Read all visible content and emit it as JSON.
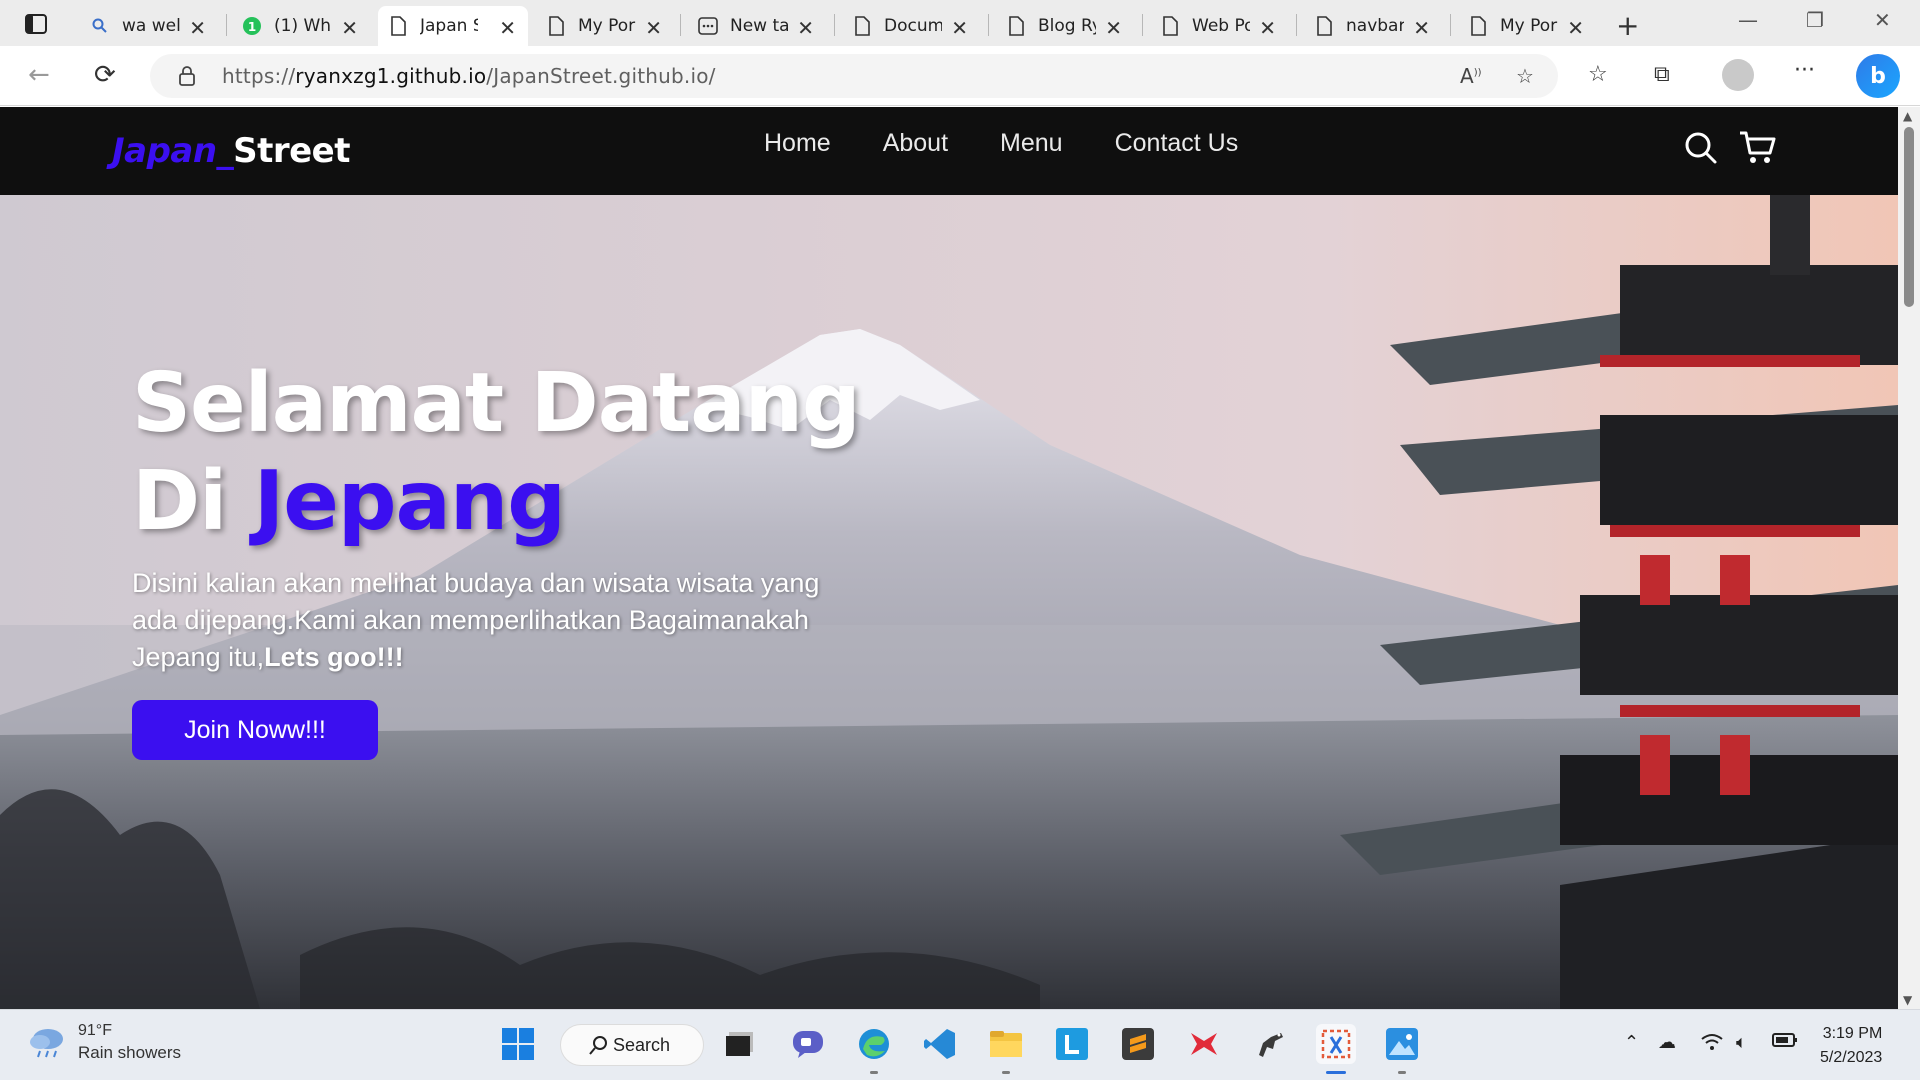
{
  "browser": {
    "tabs": [
      {
        "label": "wa wel",
        "icon": "search-icon"
      },
      {
        "label": "(1) Wh",
        "icon": "whatsapp-icon"
      },
      {
        "label": "Japan S",
        "icon": "page-icon",
        "active": true
      },
      {
        "label": "My Por",
        "icon": "page-icon"
      },
      {
        "label": "New ta",
        "icon": "newtab-icon"
      },
      {
        "label": "Docum",
        "icon": "page-icon"
      },
      {
        "label": "Blog Ry",
        "icon": "page-icon"
      },
      {
        "label": "Web Po",
        "icon": "page-icon"
      },
      {
        "label": "navbar",
        "icon": "page-icon"
      },
      {
        "label": "My Por",
        "icon": "page-icon"
      }
    ],
    "url_prefix": "https://",
    "url_host": "ryanxzg1.github.io",
    "url_path": "/JapanStreet.github.io/"
  },
  "site": {
    "logo_part1": "Japan_",
    "logo_part2": "Street",
    "nav": [
      "Home",
      "About",
      "Menu",
      "Contact Us"
    ],
    "hero": {
      "title_line1": "Selamat Datang",
      "title_line2_prefix": "Di ",
      "title_line2_accent": "Jepang",
      "description": "Disini kalian akan melihat budaya dan wisata wisata yang ada dijepang.Kami akan memperlihatkan Bagaimanakah Jepang itu,",
      "description_bold": "Lets goo!!!",
      "button": "Join Noww!!!"
    },
    "accent_color": "#3b0ff0"
  },
  "taskbar": {
    "weather_temp": "91°F",
    "weather_desc": "Rain showers",
    "search_label": "Search",
    "time": "3:19 PM",
    "date": "5/2/2023"
  }
}
